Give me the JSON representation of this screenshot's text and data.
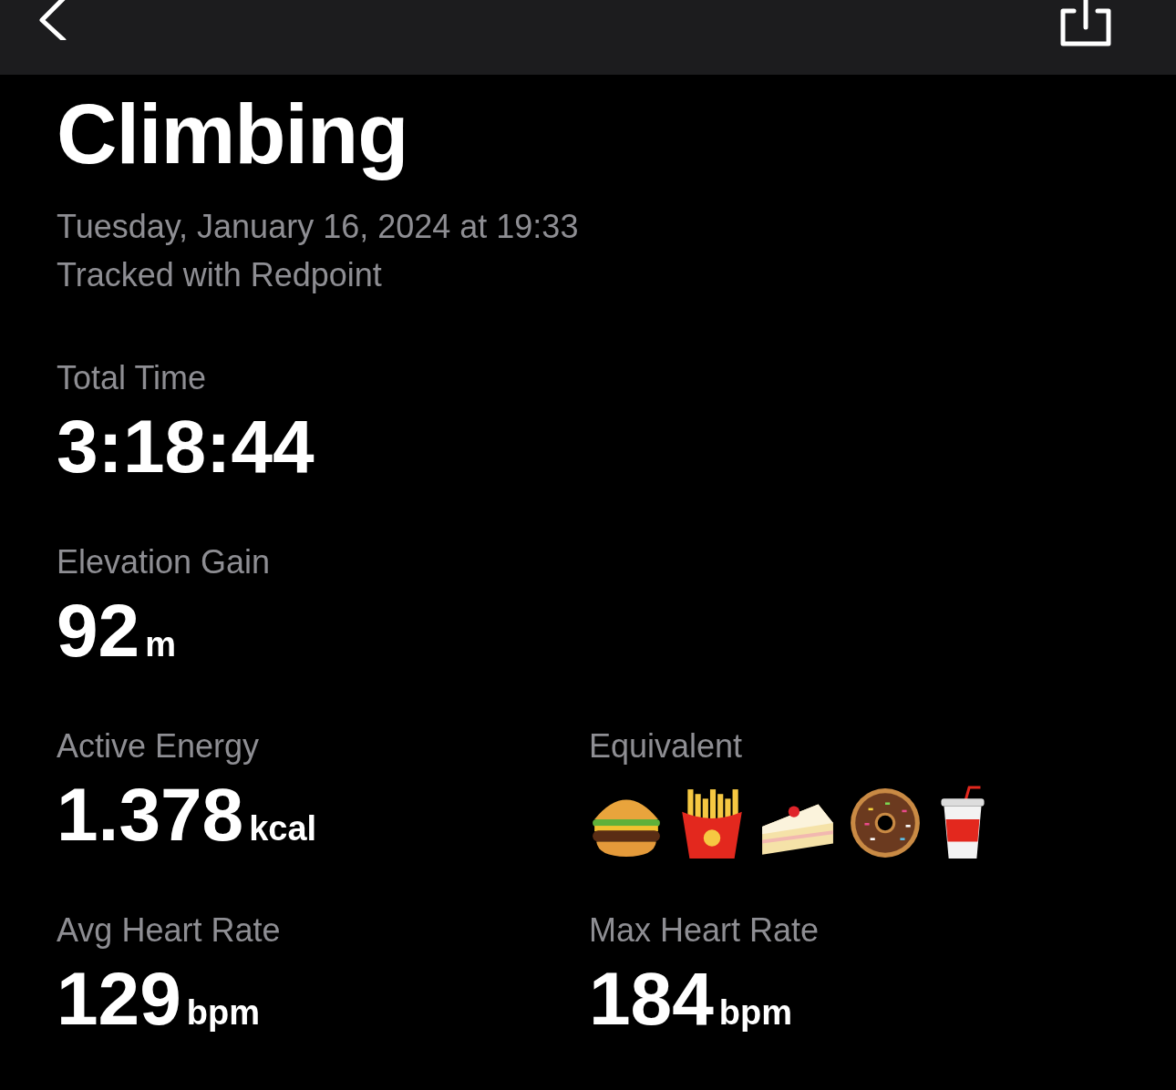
{
  "title": "Climbing",
  "subtitle_lines": [
    "Tuesday, January 16, 2024 at 19:33",
    "Tracked with Redpoint"
  ],
  "stat_rows": [
    [
      {
        "kind": "number",
        "label": "Total Time",
        "value": "3:18:44"
      }
    ],
    [
      {
        "kind": "number",
        "label": "Elevation Gain",
        "value": "92",
        "unit": "m"
      }
    ],
    [
      {
        "kind": "number",
        "label": "Active Energy",
        "value": "1.378",
        "unit": "kcal"
      },
      {
        "kind": "icons",
        "label": "Equivalent"
      }
    ],
    [
      {
        "kind": "number",
        "label": "Avg Heart Rate",
        "value": "129",
        "unit": "bpm"
      },
      {
        "kind": "number",
        "label": "Max Heart Rate",
        "value": "184",
        "unit": "bpm"
      }
    ]
  ]
}
